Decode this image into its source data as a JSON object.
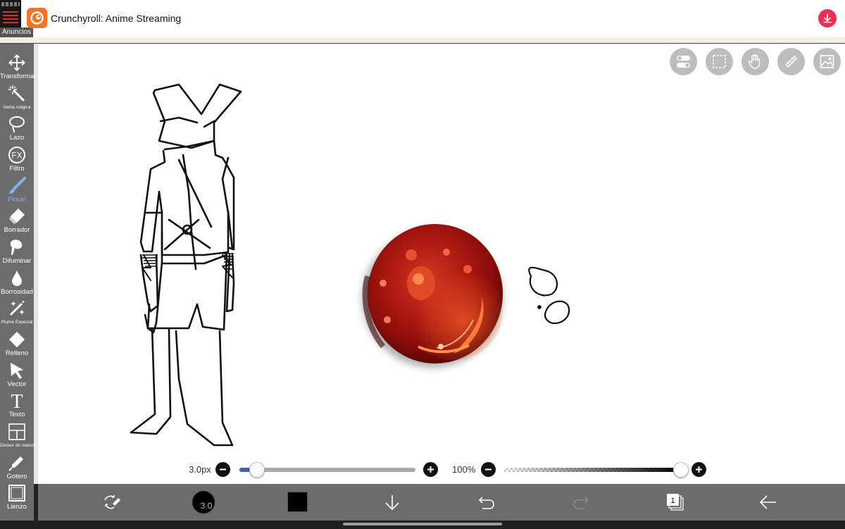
{
  "ad": {
    "tag": "Anuncios",
    "app_title": "Crunchyroll: Anime Streaming",
    "icons": {
      "logo": "crunchyroll-logo-icon",
      "download": "download-icon"
    },
    "colors": {
      "logo_bg": "#f47521",
      "download_bg": "#ee2d55"
    }
  },
  "tools": [
    {
      "label": "Transformar",
      "icon": "move-arrows-icon"
    },
    {
      "label": "Varita mágica",
      "icon": "magic-wand-icon"
    },
    {
      "label": "Lazo",
      "icon": "lasso-icon"
    },
    {
      "label": "Filtro",
      "icon": "fx-icon",
      "glyph": "FX"
    },
    {
      "label": "Pincel",
      "icon": "brush-icon",
      "active": true
    },
    {
      "label": "Borrador",
      "icon": "eraser-icon"
    },
    {
      "label": "Difuminar",
      "icon": "blur-finger-icon"
    },
    {
      "label": "Borrosidad",
      "icon": "drop-icon"
    },
    {
      "label": "Pluma Especial",
      "icon": "sparkle-pen-icon"
    },
    {
      "label": "Relleno",
      "icon": "fill-bucket-icon"
    },
    {
      "label": "Vector",
      "icon": "cursor-arrow-icon"
    },
    {
      "label": "Texto",
      "icon": "text-icon",
      "glyph": "T"
    },
    {
      "label": "Divisor de marcos",
      "icon": "frame-divider-icon"
    },
    {
      "label": "Gotero",
      "icon": "eyedropper-icon"
    },
    {
      "label": "Lienzo",
      "icon": "canvas-icon"
    }
  ],
  "quick_buttons": [
    "toggle-icon",
    "selection-icon",
    "hand-icon",
    "ruler-icon",
    "image-icon"
  ],
  "brush_size": {
    "value_label": "3.0px",
    "fraction": 0.03
  },
  "opacity": {
    "value_label": "100%",
    "fraction": 1.0
  },
  "bottom_bar": {
    "brush_indicator": "3.0",
    "current_color": "#000000",
    "layer_count": "1",
    "icons": [
      "swap-tool-icon",
      "brush-size-indicator",
      "color-swatch",
      "download-arrow-icon",
      "undo-icon",
      "redo-icon",
      "layers-icon",
      "back-arrow-icon"
    ]
  },
  "colors": {
    "accent": "#3a7bd5",
    "toolbar": "#6c6c6c",
    "active_tool": "#7cb4f0"
  }
}
